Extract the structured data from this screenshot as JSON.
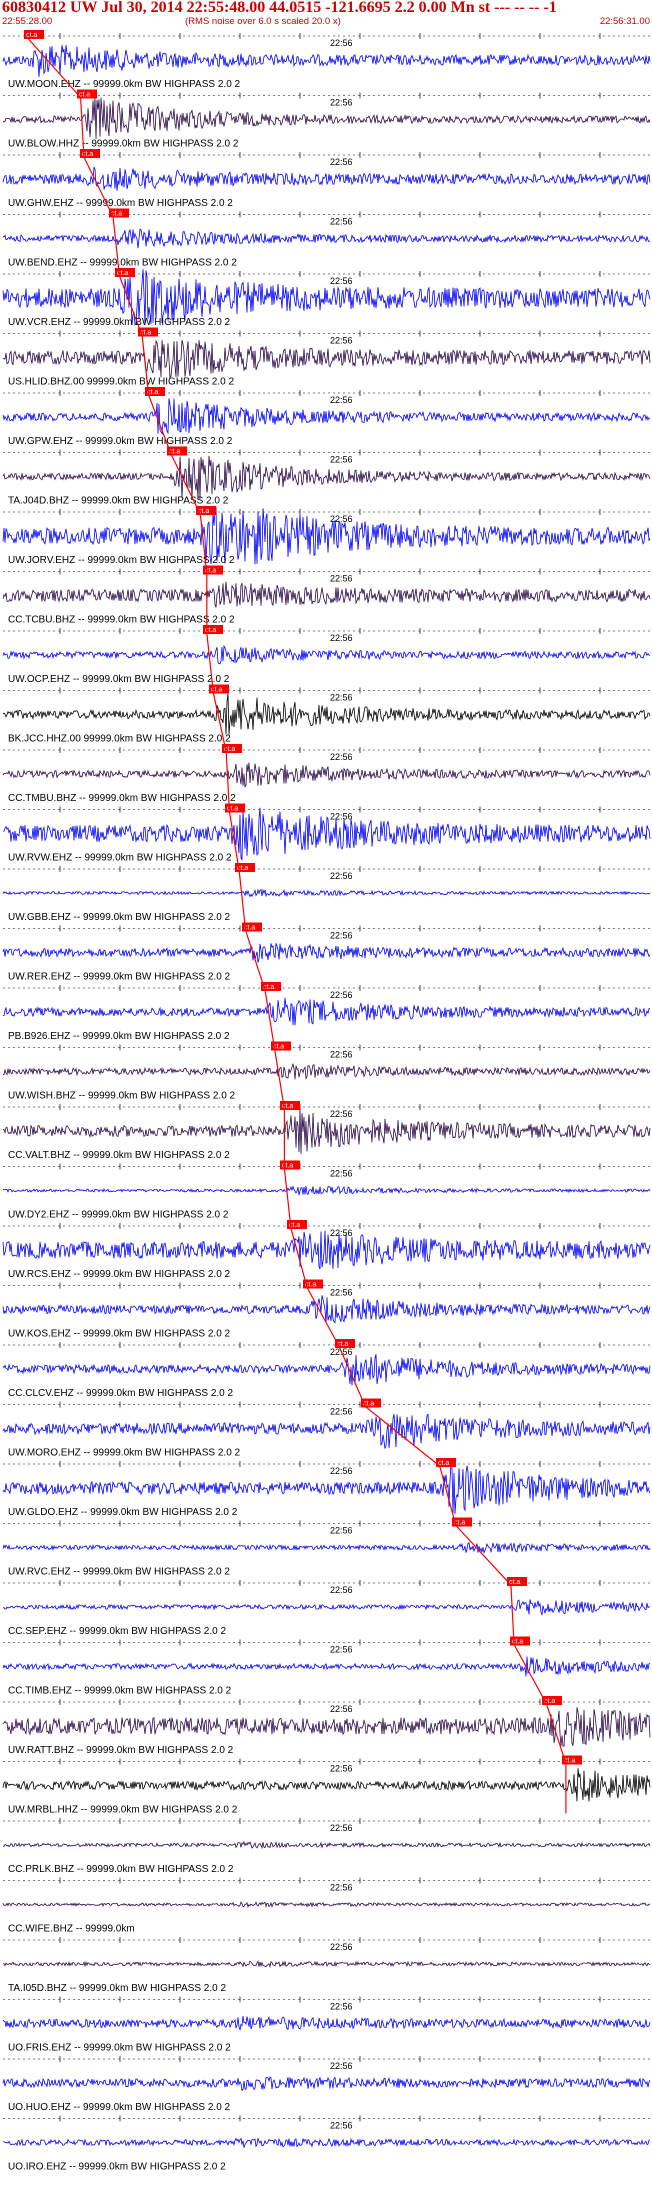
{
  "header": {
    "title": "60830412 UW Jul 30, 2014 22:55:48.00   44.0515 -121.6695  2.2 0.00 Mn st --- -- --   -1",
    "start_time": "22:55:28.00",
    "rms_note": "(RMS noise over 6.0 s scaled 20.0 x)",
    "end_time": "22:56:31.00"
  },
  "colors": {
    "blue": "#0000ff",
    "dark": "#2a0a4a",
    "black": "#000000",
    "pick": "#ff0000"
  },
  "chart_data": {
    "type": "seismogram",
    "time_range": [
      "22:55:28.00",
      "22:56:31.00"
    ],
    "minute_mark": "22:56",
    "pick_label": "ct.a",
    "traces": [
      {
        "label": "UW.MOON.EHZ -- 99999.0km BW  HIGHPASS  2.0  2",
        "color": "blue",
        "amp": 0.18,
        "burst": 0.55,
        "pick": 0.038
      },
      {
        "label": "UW.BLOW.HHZ -- 99999.0km BW  HIGHPASS  2.0  2",
        "color": "dark",
        "amp": 0.12,
        "burst": 0.85,
        "pick": 0.12
      },
      {
        "label": "UW.GHW.EHZ -- 99999.0km BW  HIGHPASS  2.0  2",
        "color": "blue",
        "amp": 0.18,
        "burst": 0.35,
        "pick": 0.125
      },
      {
        "label": "UW.BEND.EHZ -- 99999.0km BW  HIGHPASS  2.0  2",
        "color": "blue",
        "amp": 0.12,
        "burst": 0.3,
        "pick": 0.17
      },
      {
        "label": "UW.VCR.EHZ -- 99999.0km BW  HIGHPASS  2.0  2",
        "color": "blue",
        "amp": 0.35,
        "burst": 0.9,
        "pick": 0.18
      },
      {
        "label": "US.HLID.BHZ.00 99999.0km BW  HIGHPASS  2.0  2",
        "color": "dark",
        "amp": 0.25,
        "burst": 0.7,
        "pick": 0.215
      },
      {
        "label": "UW.GPW.EHZ -- 99999.0km BW  HIGHPASS  2.0  2",
        "color": "blue",
        "amp": 0.14,
        "burst": 0.7,
        "pick": 0.225
      },
      {
        "label": "TA.J04D.BHZ -- 99999.0km BW  HIGHPASS  2.0  2",
        "color": "dark",
        "amp": 0.12,
        "burst": 0.95,
        "pick": 0.26
      },
      {
        "label": "UW.JORV.EHZ -- 99999.0km BW  HIGHPASS  2.0  2",
        "color": "blue",
        "amp": 0.3,
        "burst": 1.4,
        "pick": 0.305
      },
      {
        "label": "CC.TCBU.BHZ -- 99999.0km BW  HIGHPASS  2.0  2",
        "color": "dark",
        "amp": 0.22,
        "burst": 0.35,
        "pick": 0.315
      },
      {
        "label": "UW.OCP.EHZ -- 99999.0km BW  HIGHPASS  2.0  2",
        "color": "blue",
        "amp": 0.12,
        "burst": 0.25,
        "pick": 0.315
      },
      {
        "label": "BK.JCC.HHZ.00 99999.0km BW  HIGHPASS  2.0  2",
        "color": "black",
        "amp": 0.15,
        "burst": 0.75,
        "pick": 0.325
      },
      {
        "label": "CC.TMBU.BHZ -- 99999.0km BW  HIGHPASS  2.0  2",
        "color": "dark",
        "amp": 0.12,
        "burst": 0.45,
        "pick": 0.345
      },
      {
        "label": "UW.RVW.EHZ -- 99999.0km BW  HIGHPASS  2.0  2",
        "color": "blue",
        "amp": 0.3,
        "burst": 0.9,
        "pick": 0.35
      },
      {
        "label": "UW.GBB.EHZ -- 99999.0km BW  HIGHPASS  2.0  2",
        "color": "blue",
        "amp": 0.05,
        "burst": 0.1,
        "pick": 0.365
      },
      {
        "label": "UW.RER.EHZ -- 99999.0km BW  HIGHPASS  2.0  2",
        "color": "blue",
        "amp": 0.15,
        "burst": 0.25,
        "pick": 0.375
      },
      {
        "label": "PB.B926.EHZ -- 99999.0km BW  HIGHPASS  2.0  2",
        "color": "blue",
        "amp": 0.15,
        "burst": 0.5,
        "pick": 0.405
      },
      {
        "label": "UW.WISH.BHZ -- 99999.0km BW  HIGHPASS  2.0  2",
        "color": "dark",
        "amp": 0.12,
        "burst": 0.2,
        "pick": 0.42
      },
      {
        "label": "CC.VALT.BHZ -- 99999.0km BW  HIGHPASS  2.0  2",
        "color": "dark",
        "amp": 0.2,
        "burst": 0.75,
        "pick": 0.435
      },
      {
        "label": "UW.DY2.EHZ -- 99999.0km BW  HIGHPASS  2.0  2",
        "color": "blue",
        "amp": 0.05,
        "burst": 0.15,
        "pick": 0.435
      },
      {
        "label": "UW.RCS.EHZ -- 99999.0km BW  HIGHPASS  2.0  2",
        "color": "blue",
        "amp": 0.3,
        "burst": 0.6,
        "pick": 0.445
      },
      {
        "label": "UW.KOS.EHZ -- 99999.0km BW  HIGHPASS  2.0  2",
        "color": "blue",
        "amp": 0.15,
        "burst": 0.45,
        "pick": 0.47
      },
      {
        "label": "CC.CLCV.EHZ -- 99999.0km BW  HIGHPASS  2.0  2",
        "color": "blue",
        "amp": 0.15,
        "burst": 0.6,
        "pick": 0.52
      },
      {
        "label": "UW.MORO.EHZ -- 99999.0km BW  HIGHPASS  2.0  2",
        "color": "blue",
        "amp": 0.2,
        "burst": 0.7,
        "pick": 0.56
      },
      {
        "label": "UW.GLDO.EHZ -- 99999.0km BW  HIGHPASS  2.0  2",
        "color": "blue",
        "amp": 0.22,
        "burst": 0.85,
        "pick": 0.675
      },
      {
        "label": "UW.RVC.EHZ -- 99999.0km BW  HIGHPASS  2.0  2",
        "color": "blue",
        "amp": 0.08,
        "burst": 0.15,
        "pick": 0.7
      },
      {
        "label": "CC.SEP.EHZ -- 99999.0km BW  HIGHPASS  2.0  2",
        "color": "blue",
        "amp": 0.08,
        "burst": 0.3,
        "pick": 0.785
      },
      {
        "label": "CC.TIMB.EHZ -- 99999.0km BW  HIGHPASS  2.0  2",
        "color": "blue",
        "amp": 0.1,
        "burst": 0.3,
        "pick": 0.79
      },
      {
        "label": "UW.RATT.BHZ -- 99999.0km BW  HIGHPASS  2.0  2",
        "color": "dark",
        "amp": 0.3,
        "burst": 0.55,
        "pick": 0.84
      },
      {
        "label": "UW.MRBL.HHZ -- 99999.0km BW  HIGHPASS  2.0  2",
        "color": "black",
        "amp": 0.15,
        "burst": 0.55,
        "pick": 0.87
      },
      {
        "label": "CC.PRLK.BHZ -- 99999.0km BW  HIGHPASS  2.0  2",
        "color": "dark",
        "amp": 0.06,
        "burst": 0.06,
        "pick": null
      },
      {
        "label": "CC.WIFE.BHZ -- 99999.0km",
        "color": "dark",
        "amp": 0.05,
        "burst": 0.05,
        "pick": null
      },
      {
        "label": "TA.I05D.BHZ -- 99999.0km BW  HIGHPASS  2.0  2",
        "color": "dark",
        "amp": 0.06,
        "burst": 0.06,
        "pick": null
      },
      {
        "label": "UO.FRIS.EHZ -- 99999.0km BW  HIGHPASS  2.0  2",
        "color": "blue",
        "amp": 0.15,
        "burst": 0.15,
        "pick": null
      },
      {
        "label": "UO.HUO.EHZ -- 99999.0km BW  HIGHPASS  2.0  2",
        "color": "blue",
        "amp": 0.15,
        "burst": 0.15,
        "pick": null
      },
      {
        "label": "UO.IRO.EHZ -- 99999.0km BW  HIGHPASS  2.0  2",
        "color": "blue",
        "amp": 0.1,
        "burst": 0.1,
        "pick": null
      }
    ]
  }
}
